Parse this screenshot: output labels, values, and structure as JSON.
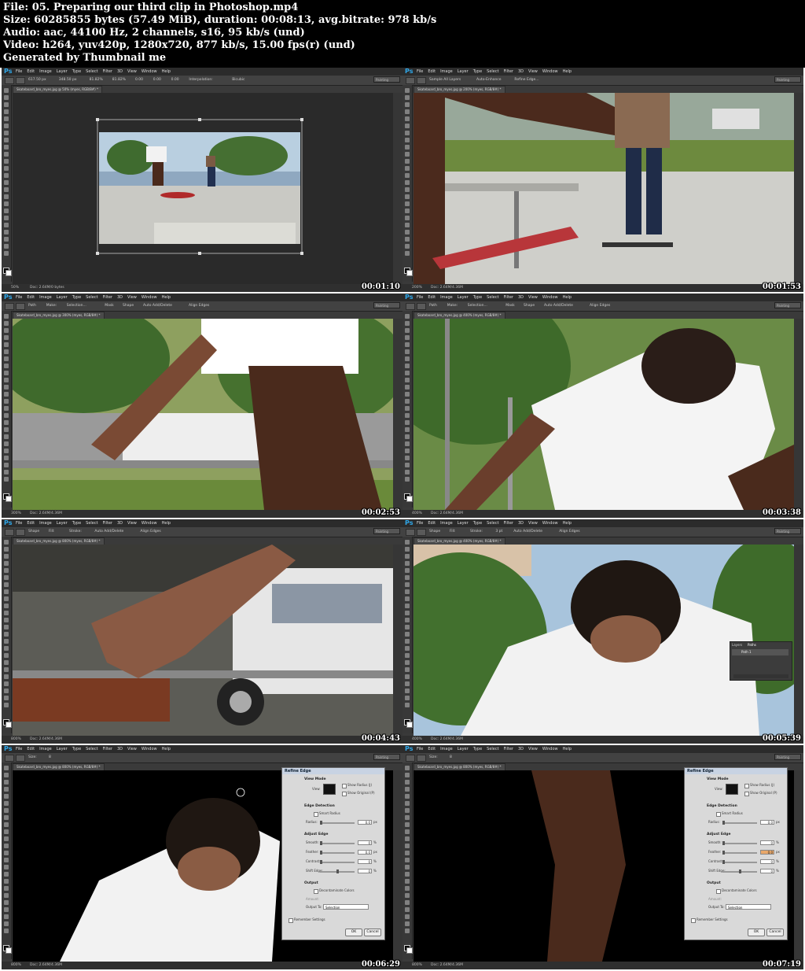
{
  "header": {
    "line1": "File: 05. Preparing our third clip in Photoshop.mp4",
    "line2": "Size: 60285855 bytes (57.49 MiB), duration: 00:08:13, avg.bitrate: 978 kb/s",
    "line3": "Audio: aac, 44100 Hz, 2 channels, s16, 95 kb/s (und)",
    "line4": "Video: h264, yuv420p, 1280x720, 877 kb/s, 15.00 fps(r) (und)",
    "line5": "Generated by Thumbnail me"
  },
  "app": {
    "logo": "Ps",
    "menus": [
      "File",
      "Edit",
      "Image",
      "Layer",
      "Type",
      "Select",
      "Filter",
      "3D",
      "View",
      "Window",
      "Help"
    ],
    "workspace": "Painting"
  },
  "frames": [
    {
      "timestamp": "00:01:10",
      "doc_tab": "Skateboard_bro_myes.jpg @ 50% (myes, RGB/8#) *",
      "zoom": "50%",
      "doc_size": "Doc: 2.64M/0 bytes",
      "options": [
        "617.50 px",
        "348.50 px",
        "81.82%",
        "81.82%",
        "0.00",
        "0.00",
        "0.00",
        "Interpolation:",
        "Bicubic"
      ]
    },
    {
      "timestamp": "00:01:53",
      "doc_tab": "Skateboard_bro_myes.jpg @ 200% (myes, RGB/8#) *",
      "zoom": "200%",
      "doc_size": "Doc: 2.64M/4.36M",
      "options": [
        "Sample All Layers",
        "Auto-Enhance",
        "Refine Edge..."
      ]
    },
    {
      "timestamp": "00:02:53",
      "doc_tab": "Skateboard_bro_myes.jpg @ 300% (myes, RGB/8#) *",
      "zoom": "300%",
      "doc_size": "Doc: 2.64M/4.36M",
      "options": [
        "Path",
        "Make:",
        "Selection...",
        "Mask",
        "Shape",
        "Auto Add/Delete",
        "Align Edges"
      ]
    },
    {
      "timestamp": "00:03:38",
      "doc_tab": "Skateboard_bro_myes.jpg @ 400% (myes, RGB/8#) *",
      "zoom": "400%",
      "doc_size": "Doc: 2.64M/4.36M",
      "options": [
        "Path",
        "Make:",
        "Selection...",
        "Mask",
        "Shape",
        "Auto Add/Delete",
        "Align Edges"
      ]
    },
    {
      "timestamp": "00:04:43",
      "doc_tab": "Skateboard_bro_myes.jpg @ 800% (myes, RGB/8#) *",
      "zoom": "800%",
      "doc_size": "Doc: 2.64M/4.36M",
      "options": [
        "Shape",
        "Fill:",
        "Stroke:",
        "Auto Add/Delete",
        "Align Edges"
      ]
    },
    {
      "timestamp": "00:05:39",
      "doc_tab": "Skateboard_bro_myes.jpg @ 400% (myes, RGB/8#) *",
      "zoom": "400%",
      "doc_size": "Doc: 2.64M/4.36M",
      "options": [
        "Shape",
        "Fill:",
        "Stroke:",
        "3 pt",
        "Auto Add/Delete",
        "Align Edges"
      ],
      "paths_panel": {
        "tabs": [
          "Layers",
          "Paths"
        ],
        "item": "Path 1"
      }
    },
    {
      "timestamp": "00:06:29",
      "doc_tab": "Skateboard_bro_myes.jpg @ 800% (myes, RGB/8#) *",
      "zoom": "800%",
      "doc_size": "Doc: 2.64M/4.36M",
      "options": [
        "Size:",
        "8"
      ]
    },
    {
      "timestamp": "00:07:19",
      "doc_tab": "Skateboard_bro_myes.jpg @ 800% (myes, RGB/8#) *",
      "zoom": "800%",
      "doc_size": "Doc: 2.64M/4.36M",
      "options": [
        "Size:",
        "8"
      ]
    }
  ],
  "refine_edge": {
    "title": "Refine Edge",
    "view_mode": "View Mode",
    "view_label": "View:",
    "show_radius": "Show Radius (J)",
    "show_original": "Show Original (P)",
    "edge_detection": "Edge Detection",
    "smart_radius": "Smart Radius",
    "radius_label": "Radius:",
    "radius_value": "0.0",
    "adjust_edge": "Adjust Edge",
    "smooth_label": "Smooth:",
    "smooth_value": "0",
    "feather_label": "Feather:",
    "feather_value": "0.0",
    "contrast_label": "Contrast:",
    "contrast_value": "0",
    "shift_label": "Shift Edge:",
    "shift_value": "0",
    "unit_px": "px",
    "unit_pct": "%",
    "output": "Output",
    "decontaminate": "Decontaminate Colors",
    "amount_label": "Amount:",
    "output_to_label": "Output To:",
    "output_to_value": "Selection",
    "remember": "Remember Settings",
    "ok": "OK",
    "cancel": "Cancel"
  }
}
